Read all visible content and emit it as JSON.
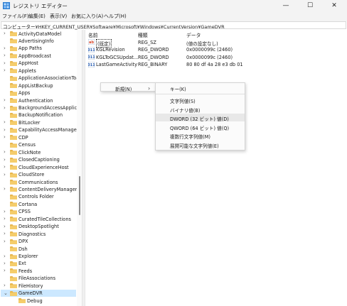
{
  "window": {
    "title": "レジストリ エディター",
    "minimize_glyph": "—",
    "maximize_glyph": "☐",
    "close_glyph": "✕"
  },
  "menu": [
    "ファイル(F)",
    "編集(E)",
    "表示(V)",
    "お気に入り(A)",
    "ヘルプ(H)"
  ],
  "address": "コンピューター¥HKEY_CURRENT_USER¥Software¥Microsoft¥Windows¥CurrentVersion¥GameDVR",
  "tree": {
    "items": [
      {
        "label": "ActivityDataModel",
        "chevron": true
      },
      {
        "label": "AdvertisingInfo",
        "chevron": false
      },
      {
        "label": "App Paths",
        "chevron": true
      },
      {
        "label": "AppBroadcast",
        "chevron": true
      },
      {
        "label": "AppHost",
        "chevron": true
      },
      {
        "label": "Applets",
        "chevron": true
      },
      {
        "label": "ApplicationAssociationToas",
        "chevron": false
      },
      {
        "label": "AppListBackup",
        "chevron": false
      },
      {
        "label": "Apps",
        "chevron": false
      },
      {
        "label": "Authentication",
        "chevron": true
      },
      {
        "label": "BackgroundAccessApplicat",
        "chevron": true
      },
      {
        "label": "BackupNotification",
        "chevron": false
      },
      {
        "label": "BitLocker",
        "chevron": true
      },
      {
        "label": "CapabilityAccessManager",
        "chevron": true
      },
      {
        "label": "CDP",
        "chevron": true
      },
      {
        "label": "Census",
        "chevron": false
      },
      {
        "label": "ClickNote",
        "chevron": true
      },
      {
        "label": "ClosedCaptioning",
        "chevron": true
      },
      {
        "label": "CloudExperienceHost",
        "chevron": true
      },
      {
        "label": "CloudStore",
        "chevron": true
      },
      {
        "label": "Communications",
        "chevron": false
      },
      {
        "label": "ContentDeliveryManager",
        "chevron": true
      },
      {
        "label": "Controls Folder",
        "chevron": false
      },
      {
        "label": "Cortana",
        "chevron": false
      },
      {
        "label": "CPSS",
        "chevron": true
      },
      {
        "label": "CuratedTileCollections",
        "chevron": true
      },
      {
        "label": "DesktopSpotlight",
        "chevron": true
      },
      {
        "label": "Diagnostics",
        "chevron": true
      },
      {
        "label": "DPX",
        "chevron": true
      },
      {
        "label": "Dsh",
        "chevron": false
      },
      {
        "label": "Explorer",
        "chevron": true
      },
      {
        "label": "Ext",
        "chevron": true
      },
      {
        "label": "Feeds",
        "chevron": true
      },
      {
        "label": "FileAssociations",
        "chevron": false
      },
      {
        "label": "FileHistory",
        "chevron": true
      },
      {
        "label": "GameDVR",
        "chevron": true,
        "expanded": true,
        "selected": true
      },
      {
        "label": "Debug",
        "chevron": false,
        "child": true
      }
    ]
  },
  "list": {
    "columns": {
      "name": "名前",
      "type": "種類",
      "data": "データ"
    },
    "rows": [
      {
        "name": "(既定)",
        "type": "REG_SZ",
        "data": "(値の設定なし)",
        "icon": "string-value-icon",
        "default": true
      },
      {
        "name": "KGLRevision",
        "type": "REG_DWORD",
        "data": "0x0000099c (2460)",
        "icon": "binary-value-icon"
      },
      {
        "name": "KGLToGCSUpdat...",
        "type": "REG_DWORD",
        "data": "0x0000099c (2460)",
        "icon": "binary-value-icon"
      },
      {
        "name": "LastGameActivity",
        "type": "REG_BINARY",
        "data": "80 80 df 4a 28 e3 db 01",
        "icon": "binary-value-icon"
      }
    ]
  },
  "context_menu": {
    "new_label": "新規(N)",
    "submenu": {
      "key": "キー(K)",
      "items": [
        {
          "label": "文字列値(S)"
        },
        {
          "label": "バイナリ値(B)"
        },
        {
          "label": "DWORD (32 ビット) 値(D)",
          "highlighted": true
        },
        {
          "label": "QWORD (64 ビット) 値(Q)"
        },
        {
          "label": "複数行文字列値(M)"
        },
        {
          "label": "展開可能な文字列値(E)"
        }
      ]
    }
  },
  "colors": {
    "selection": "#cce8ff",
    "folder": "#e8b64c",
    "value_icon_blue": "#2b5fb3",
    "value_icon_red": "#d9482b"
  }
}
